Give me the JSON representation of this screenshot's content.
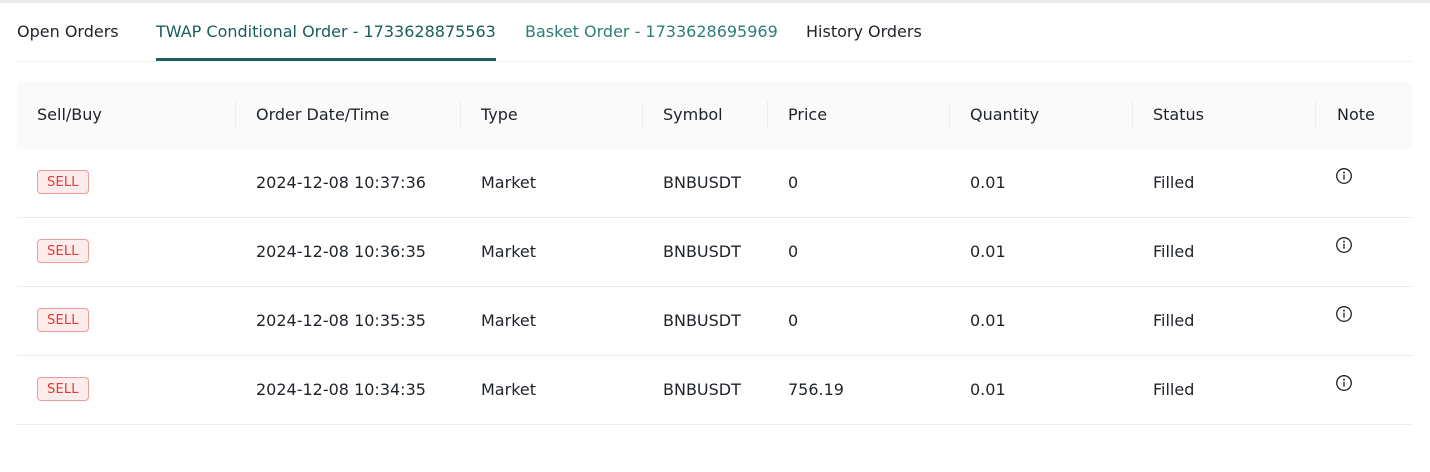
{
  "tabs": [
    {
      "label": "Open Orders",
      "state": "default"
    },
    {
      "label": "TWAP Conditional Order - 1733628875563",
      "state": "active"
    },
    {
      "label": "Basket Order - 1733628695969",
      "state": "accent"
    },
    {
      "label": "History Orders",
      "state": "default"
    }
  ],
  "table": {
    "headers": [
      "Sell/Buy",
      "Order Date/Time",
      "Type",
      "Symbol",
      "Price",
      "Quantity",
      "Status",
      "Note"
    ],
    "rows": [
      {
        "side": "SELL",
        "datetime": "2024-12-08 10:37:36",
        "type": "Market",
        "symbol": "BNBUSDT",
        "price": "0",
        "quantity": "0.01",
        "status": "Filled",
        "note_icon": "info-icon"
      },
      {
        "side": "SELL",
        "datetime": "2024-12-08 10:36:35",
        "type": "Market",
        "symbol": "BNBUSDT",
        "price": "0",
        "quantity": "0.01",
        "status": "Filled",
        "note_icon": "info-icon"
      },
      {
        "side": "SELL",
        "datetime": "2024-12-08 10:35:35",
        "type": "Market",
        "symbol": "BNBUSDT",
        "price": "0",
        "quantity": "0.01",
        "status": "Filled",
        "note_icon": "info-icon"
      },
      {
        "side": "SELL",
        "datetime": "2024-12-08 10:34:35",
        "type": "Market",
        "symbol": "BNBUSDT",
        "price": "756.19",
        "quantity": "0.01",
        "status": "Filled",
        "note_icon": "info-icon"
      }
    ]
  },
  "colors": {
    "active_tab": "#1a5d5a",
    "accent_tab": "#2e7d77",
    "sell": "#e53935",
    "header_bg": "#fafafa"
  }
}
